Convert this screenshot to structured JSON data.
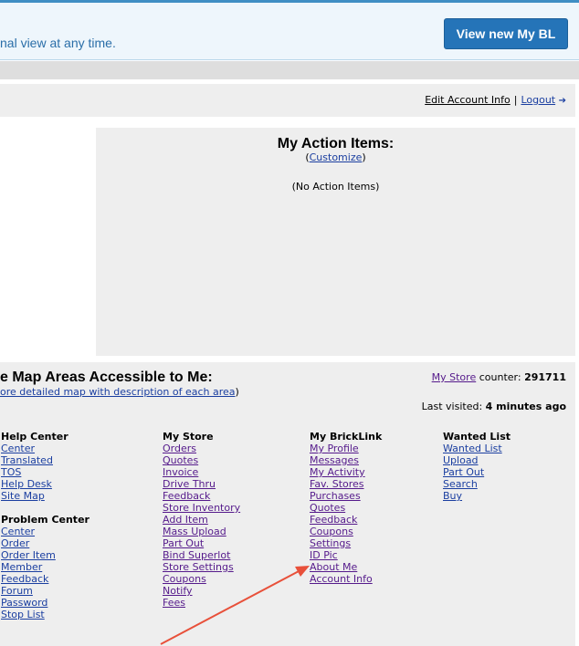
{
  "banner": {
    "text": "nal view at any time.",
    "button_label": "View new My BL"
  },
  "account": {
    "edit_label": "Edit Account Info",
    "separator": "|",
    "logout_label": "Logout"
  },
  "action_items": {
    "title": "My Action Items:",
    "customize_open": "(",
    "customize_label": "Customize",
    "customize_close": ")",
    "empty_text": "(No Action Items)"
  },
  "site_map": {
    "title": "e Map Areas Accessible to Me:",
    "sub_link": "ore detailed map with description of each area",
    "sub_close": ")",
    "store_link": "My Store",
    "counter_label": "counter:",
    "counter_value": "291711",
    "last_visited_label": "Last visited:",
    "last_visited_value": "4 minutes ago"
  },
  "columns": {
    "help_center": {
      "heading": "Help Center",
      "items": [
        "Center",
        "Translated",
        "TOS",
        "Help Desk",
        "Site Map"
      ]
    },
    "problem_center": {
      "heading": "Problem Center",
      "items": [
        "Center",
        "Order",
        "Order Item",
        "Member",
        "Feedback",
        "Forum",
        "Password",
        "Stop List"
      ]
    },
    "my_store": {
      "heading": "My Store",
      "items": [
        "Orders",
        "Quotes",
        "Invoice",
        "Drive Thru",
        "Feedback",
        "Store Inventory",
        "Add Item",
        "Mass Upload",
        "Part Out",
        "Bind Superlot",
        "Store Settings",
        "Coupons",
        "Notify",
        "Fees"
      ]
    },
    "my_bricklink": {
      "heading": "My BrickLink",
      "items": [
        "My Profile",
        "Messages",
        "My Activity",
        "Fav. Stores",
        "Purchases",
        "Quotes",
        "Feedback",
        "Coupons",
        "Settings",
        "ID Pic",
        "About Me",
        "Account Info"
      ]
    },
    "wanted_list": {
      "heading": "Wanted List",
      "items": [
        "Wanted List",
        "Upload",
        "Part Out",
        "Search",
        "Buy"
      ]
    }
  },
  "colors": {
    "link": "#1a3ea0",
    "visited": "#551a8b",
    "banner_button": "#2574b8",
    "annotation_arrow": "#e8503a"
  }
}
